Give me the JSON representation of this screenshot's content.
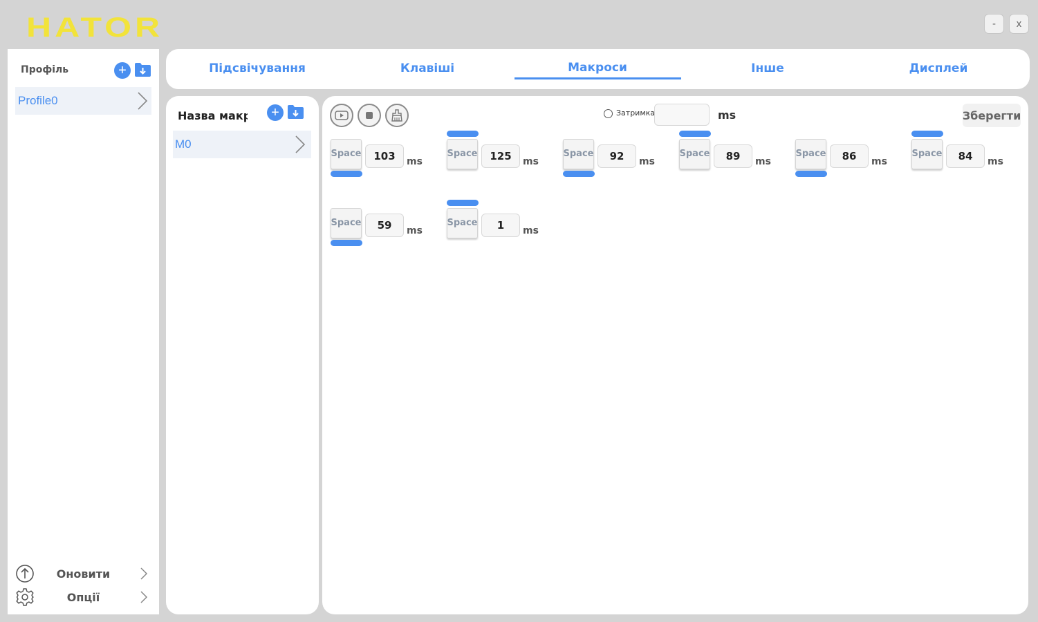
{
  "app": {
    "logo": "HATOR",
    "minimize_label": "-",
    "close_label": "x"
  },
  "colors": {
    "accent": "#4a8ff0",
    "logo": "#f2e33a",
    "background": "#d4d4d4"
  },
  "sidebar": {
    "title": "Профіль",
    "add_icon": "plus-circle-icon",
    "import_icon": "folder-download-icon",
    "profiles": [
      {
        "label": "Profile0",
        "selected": true
      }
    ],
    "footer": [
      {
        "label": "Оновити",
        "icon": "upload-circle-icon"
      },
      {
        "label": "Опції",
        "icon": "gear-icon"
      }
    ]
  },
  "tabs": [
    {
      "label": "Підсвічування",
      "active": false
    },
    {
      "label": "Клавіші",
      "active": false
    },
    {
      "label": "Макроси",
      "active": true
    },
    {
      "label": "Інше",
      "active": false
    },
    {
      "label": "Дисплей",
      "active": false
    }
  ],
  "macros": {
    "title": "Назва макросу",
    "items": [
      {
        "label": "M0",
        "selected": true
      }
    ]
  },
  "editor": {
    "tools": [
      "record-icon",
      "stop-icon",
      "clear-icon"
    ],
    "delay_label": "Затримка",
    "delay_value": "",
    "delay_unit": "ms",
    "save_label": "Зберегти",
    "steps": [
      {
        "key": "Space",
        "duration": "103",
        "unit": "ms",
        "action": "up"
      },
      {
        "key": "Space",
        "duration": "125",
        "unit": "ms",
        "action": "down"
      },
      {
        "key": "Space",
        "duration": "92",
        "unit": "ms",
        "action": "up"
      },
      {
        "key": "Space",
        "duration": "89",
        "unit": "ms",
        "action": "down"
      },
      {
        "key": "Space",
        "duration": "86",
        "unit": "ms",
        "action": "up"
      },
      {
        "key": "Space",
        "duration": "84",
        "unit": "ms",
        "action": "down"
      },
      {
        "key": "Space",
        "duration": "59",
        "unit": "ms",
        "action": "up"
      },
      {
        "key": "Space",
        "duration": "1",
        "unit": "ms",
        "action": "down"
      }
    ]
  }
}
